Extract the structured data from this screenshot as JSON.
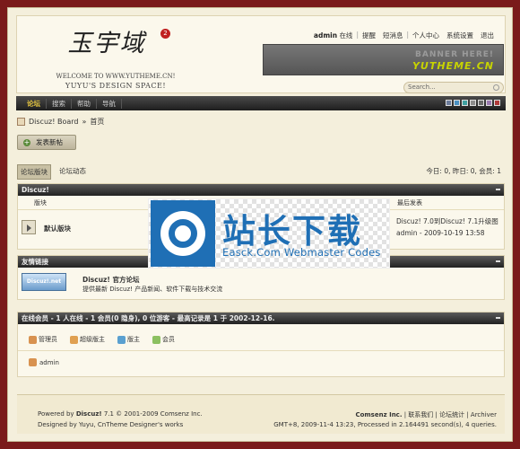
{
  "header": {
    "logo_title": "玉宇域",
    "logo_badge": "2",
    "logo_line1": "WELCOME TO WWW.YUTHEME.CN!",
    "logo_line2": "YUYU'S DESIGN SPACE!",
    "user_nav": {
      "username": "admin",
      "status": "在线",
      "links": [
        "提醒",
        "短消息",
        "个人中心",
        "系统设置",
        "退出"
      ]
    },
    "banner": {
      "line1": "BANNER HERE!",
      "line2": "YUTHEME.CN"
    },
    "search_placeholder": "Search..."
  },
  "nav": {
    "items": [
      "论坛",
      "搜索",
      "帮助",
      "导航"
    ],
    "active": "论坛",
    "swatch_colors": [
      "#6b7b9a",
      "#4a90c2",
      "#3fa0a0",
      "#8c8c8c",
      "#6a6a6a",
      "#9a7ab0",
      "#b03a3a"
    ]
  },
  "breadcrumb": {
    "board": "Discuz! Board",
    "sep": "»",
    "current": "首页"
  },
  "new_post_label": "发表新帖",
  "tabs": [
    "论坛版块",
    "论坛动态"
  ],
  "stats": "今日: 0, 昨日: 0, 会员: 1",
  "forum_section": {
    "title": "Discuz!",
    "col_board": "版块",
    "col_last": "最后发表",
    "board_name": "默认版块",
    "last_post_title": "Discuz! 7.0到Discuz! 7.1升级图",
    "last_post_meta": "admin - 2009-10-19 13:58"
  },
  "links_section": {
    "title": "友情链接",
    "logo_text": "Discuz!.net",
    "link_title": "Discuz! 官方论坛",
    "link_desc": "提供最新 Discuz! 产品新闻、软件下载与技术交流"
  },
  "online_section": {
    "title": "在线会员 - 1 人在线 - 1 会员(0 隐身), 0 位游客 - 最高记录是 1 于 2002-12-16.",
    "legend": [
      {
        "label": "管理员",
        "color": "#d89250"
      },
      {
        "label": "超级版主",
        "color": "#e0a050"
      },
      {
        "label": "版主",
        "color": "#5aa0d0"
      },
      {
        "label": "会员",
        "color": "#8cc060"
      }
    ],
    "online_user": "admin"
  },
  "footer": {
    "line1_prefix": "Powered by",
    "line1_brand": "Discuz!",
    "line1_rest": "7.1 © 2001-2009 Comsenz Inc.",
    "line2": "Designed by Yuyu, CnTheme Designer's works",
    "right1_company": "Comsenz Inc.",
    "right1_links": "| 联系我们 | 论坛统计 | Archiver",
    "right2": "GMT+8, 2009-11-4 13:23, Processed in 2.164491 second(s), 4 queries."
  },
  "watermark": {
    "cn_text": "站长下载",
    "en_text": "Easck.Com Webmaster Codes"
  }
}
